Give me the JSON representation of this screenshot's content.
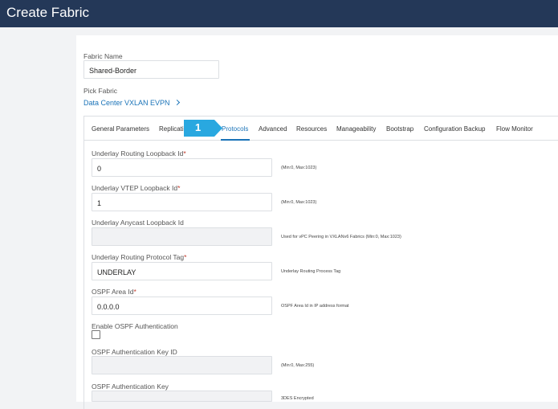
{
  "window": {
    "title": "Create Fabric"
  },
  "fabric_name": {
    "label": "Fabric Name",
    "value": "Shared-Border"
  },
  "pick_fabric": {
    "label": "Pick Fabric",
    "value": "Data Center VXLAN EVPN"
  },
  "tabs": [
    {
      "label": "General Parameters"
    },
    {
      "label": "Replicati"
    },
    {
      "label": "Protocols",
      "active": true
    },
    {
      "label": "Advanced"
    },
    {
      "label": "Resources"
    },
    {
      "label": "Manageability"
    },
    {
      "label": "Bootstrap"
    },
    {
      "label": "Configuration Backup"
    },
    {
      "label": "Flow Monitor"
    }
  ],
  "callout": {
    "text": "1",
    "color": "#29a8e0"
  },
  "form": {
    "underlay_routing_loopback": {
      "label": "Underlay Routing Loopback Id",
      "value": "0",
      "hint": "(Min:0, Max:1023)"
    },
    "underlay_vtep_loopback": {
      "label": "Underlay VTEP Loopback Id",
      "value": "1",
      "hint": "(Min:0, Max:1023)"
    },
    "underlay_anycast_loopback": {
      "label": "Underlay Anycast Loopback Id",
      "value": "",
      "hint": "Used for vPC Peering in VXLANv6 Fabrics (Min:0, Max:1023)"
    },
    "underlay_routing_protocol_tag": {
      "label": "Underlay Routing Protocol Tag",
      "value": "UNDERLAY",
      "hint": "Underlay Routing Process Tag"
    },
    "ospf_area_id": {
      "label": "OSPF Area Id",
      "value": "0.0.0.0",
      "hint": "OSPF Area Id in IP address format"
    },
    "enable_ospf_auth": {
      "label": "Enable OSPF Authentication",
      "checked": false
    },
    "ospf_auth_key_id": {
      "label": "OSPF Authentication Key ID",
      "value": "",
      "hint": "(Min:0, Max:255)"
    },
    "ospf_auth_key": {
      "label": "OSPF Authentication Key",
      "value": "",
      "hint": "3DES Encrypted"
    }
  },
  "required_mark": "*",
  "colors": {
    "header": "#243858",
    "link": "#1a73b8",
    "required": "#c0392b"
  }
}
